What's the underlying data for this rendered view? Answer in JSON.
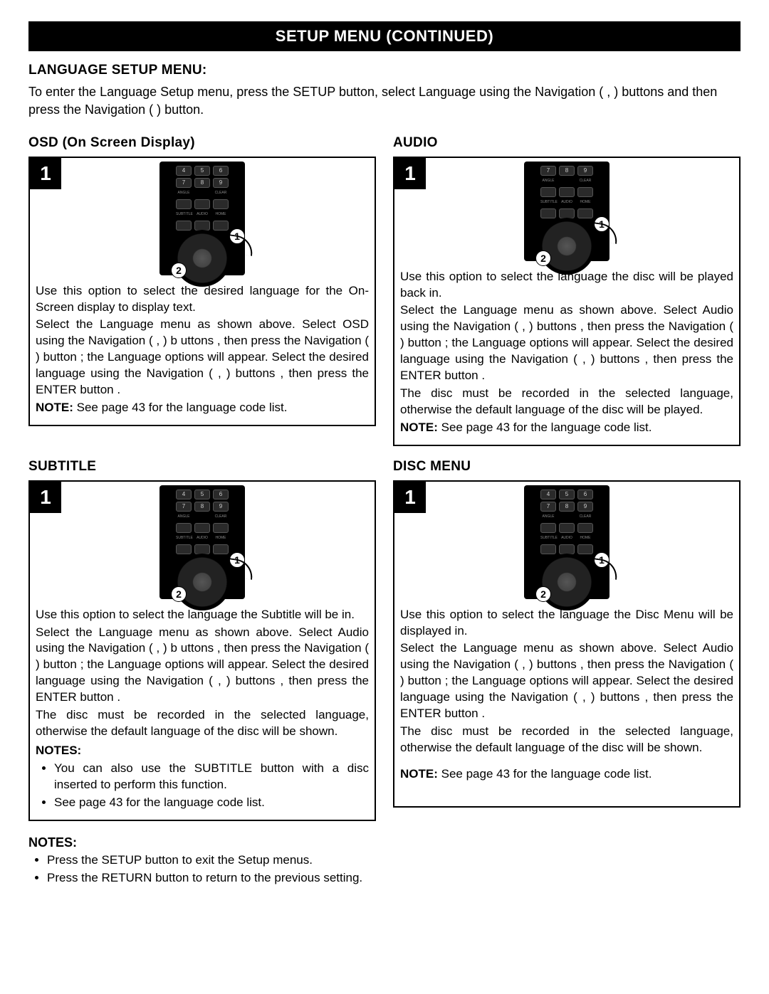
{
  "banner": "SETUP MENU (CONTINUED)",
  "lang_setup": {
    "title": "LANGUAGE SETUP MENU:",
    "intro": "To enter the Language Setup menu, press the SETUP button, select Language using the Navigation ( ,   ) buttons and then press the Navigation ( )   button."
  },
  "osd": {
    "title": "OSD (On Screen Display)",
    "step": "1",
    "p1": "Use this option to select the desired language for the On-Screen display to display text.",
    "p2": "Select the Language menu as shown above. Select OSD using the Navigation ( ,   ) b uttons   , then press the Navigation ( )   button   ; the Language options will appear. Select the desired language using the Navigation ( ,   ) buttons   , then press the ENTER button   .",
    "note_label": "NOTE:",
    "note": " See page 43 for the language code list."
  },
  "audio": {
    "title": "AUDIO",
    "step": "1",
    "p1": "Use this option to select the language the disc will be played back in.",
    "p2": "Select the Language menu as shown above. Select Audio using the Navigation ( ,   )   buttons   , then press the Navigation ( )   button   ; the Language options will appear. Select the desired language using the Navigation ( ,   ) buttons   , then press the ENTER button   .",
    "p3": "The disc must be recorded in the selected language, otherwise the default language of the disc will be played.",
    "note_label": "NOTE:",
    "note": " See page 43 for the language code list."
  },
  "subtitle": {
    "title": "SUBTITLE",
    "step": "1",
    "p1": "Use this option to select the language the Subtitle will be in.",
    "p2": "Select the Language menu as shown above. Select Audio using the Navigation ( ,   ) b uttons   , then press the Navigation ( )   button   ; the Language options will appear. Select the desired language using the Navigation ( ,   ) buttons   , then press the ENTER button   .",
    "p3": "The disc must be recorded in the selected language, otherwise the default language of the disc will be shown.",
    "notes_label": "NOTES:",
    "notes": [
      "You can also use the SUBTITLE button with a disc inserted to perform this function.",
      "See page 43 for the language code list."
    ]
  },
  "discmenu": {
    "title": "DISC MENU",
    "step": "1",
    "p1": "Use this option to select the language the Disc Menu will be displayed in.",
    "p2": "Select the Language menu as shown above. Select Audio using the Navigation ( ,   )   buttons   , then press the Navigation ( )   button   ; the Language options will appear. Select the desired language using the Navigation ( ,   ) buttons   , then press the ENTER button   .",
    "p3": "The disc must be recorded in the selected language, otherwise the default language of the disc will be shown.",
    "note_label": "NOTE:",
    "note": " See page 43 for the language code list."
  },
  "footer": {
    "label": "NOTES:",
    "items": [
      "Press the SETUP button to exit the Setup menus.",
      "Press the RETURN button to return to the previous setting."
    ]
  },
  "remote": {
    "row1": [
      "4",
      "5",
      "6"
    ],
    "row2": [
      "7",
      "8",
      "9"
    ],
    "row3_labels": [
      "ANGLE",
      "",
      "CLEAR"
    ],
    "row4_labels": [
      "SUBTITLE",
      "AUDIO",
      "HOME"
    ],
    "callout1": "1",
    "callout2": "2"
  }
}
